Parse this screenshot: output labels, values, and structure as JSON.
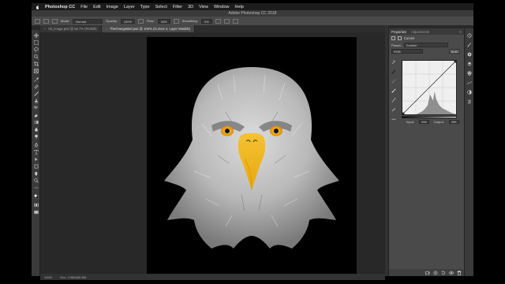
{
  "menubar": {
    "app_name": "Photoshop CC",
    "items": [
      "File",
      "Edit",
      "Image",
      "Layer",
      "Type",
      "Select",
      "Filter",
      "3D",
      "View",
      "Window",
      "Help"
    ]
  },
  "window": {
    "title": "Adobe Photoshop CC 2018"
  },
  "options": {
    "mode_label": "Mode:",
    "mode_value": "Normal",
    "opacity_label": "Opacity:",
    "opacity_value": "100%",
    "flow_label": "Flow:",
    "flow_value": "34%",
    "smoothing_label": "Smoothing:",
    "smoothing_value": "0%"
  },
  "document_tabs": [
    {
      "label": "03_image.psd @ 66.7% (RGB/8)",
      "close": "×",
      "active": false
    },
    {
      "label": "TheOrangeBird.psd @ 100% (Curves 3, Layer Mask/8)",
      "close": "×",
      "active": true
    }
  ],
  "status": {
    "zoom": "100%",
    "doc_info": "Doc: 4.96M/80.8M"
  },
  "properties_panel": {
    "tabs": [
      "Properties",
      "Adjustments"
    ],
    "menu_icon": "≡",
    "title": "Curves",
    "preset_label": "Preset:",
    "preset_value": "Custom",
    "channel_value": "RGB",
    "auto_label": "Auto",
    "input_label": "Input:",
    "input_value": "255",
    "output_label": "Output:",
    "output_value": "255"
  },
  "colors": {
    "ui_dark": "#282828",
    "panel": "#4a4a4a",
    "beak": "#f2b21a",
    "eye": "#e89a10"
  },
  "icons": {
    "apple": "apple-icon",
    "move": "move-tool-icon",
    "brush": "brush-icon",
    "crop": "crop-icon",
    "text": "type-tool-icon",
    "zoom": "zoom-icon",
    "hand": "hand-icon",
    "eye": "visibility-icon",
    "trash": "trash-icon"
  }
}
